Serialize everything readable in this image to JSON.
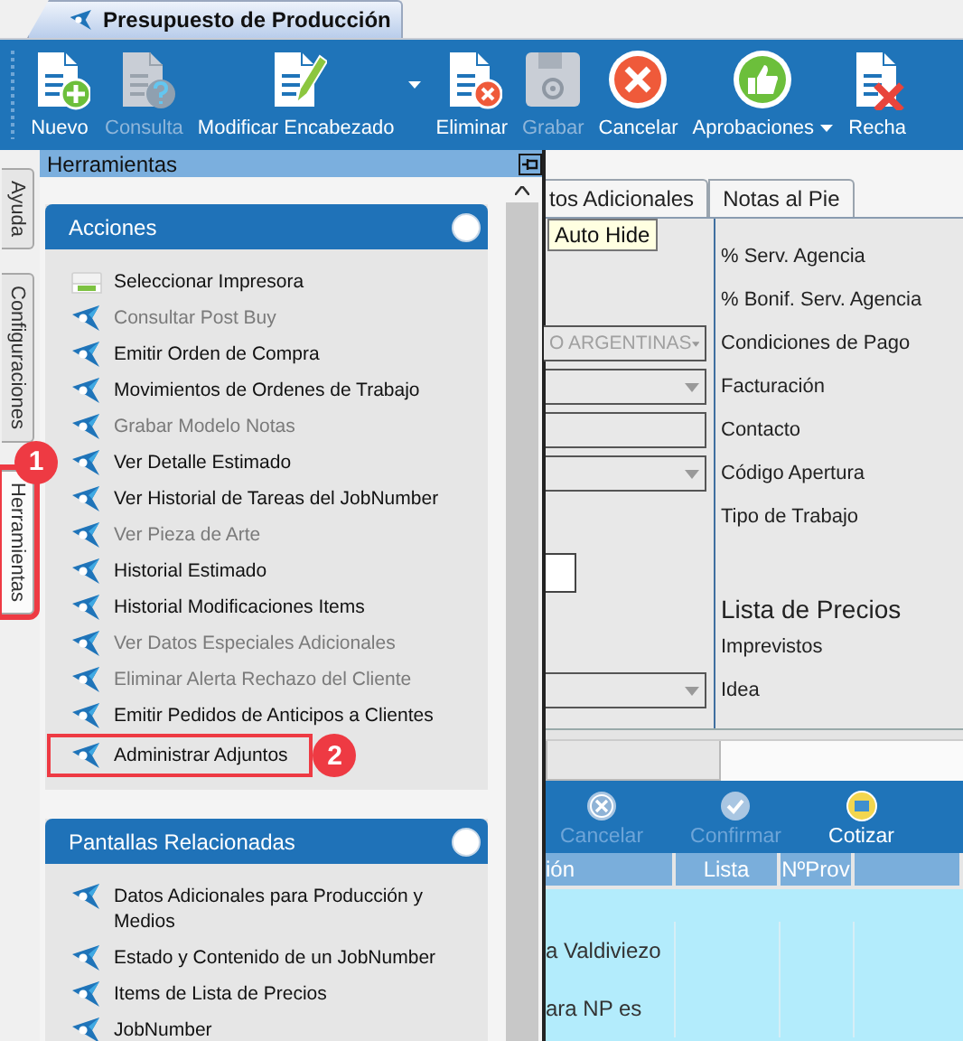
{
  "window_tab": {
    "title": "Presupuesto de Producción"
  },
  "toolbar": [
    {
      "label": "Nuevo",
      "kind": "new",
      "disabled": false,
      "dropdown": false
    },
    {
      "label": "Consulta",
      "kind": "query",
      "disabled": true,
      "dropdown": false
    },
    {
      "label": "Modificar Encabezado",
      "kind": "edit",
      "disabled": false,
      "dropdown": true,
      "split": true
    },
    {
      "label": "Eliminar",
      "kind": "delete",
      "disabled": false,
      "dropdown": false
    },
    {
      "label": "Grabar",
      "kind": "save",
      "disabled": true,
      "dropdown": false
    },
    {
      "label": "Cancelar",
      "kind": "cancel",
      "disabled": false,
      "dropdown": false
    },
    {
      "label": "Aprobaciones",
      "kind": "approve",
      "disabled": false,
      "dropdown": true,
      "split": false
    },
    {
      "label": "Recha",
      "kind": "reject",
      "disabled": false,
      "dropdown": false
    }
  ],
  "side_tabs": [
    {
      "label": "Ayuda",
      "selected": false
    },
    {
      "label": "Configuraciones",
      "selected": false
    },
    {
      "label": "Herramientas",
      "selected": true,
      "callout": "1"
    }
  ],
  "tools_panel": {
    "title": "Herramientas",
    "tooltip": "Auto Hide",
    "groups": [
      {
        "title": "Acciones",
        "items": [
          {
            "label": "Seleccionar Impresora",
            "kind": "printer",
            "disabled": false
          },
          {
            "label": "Consultar Post Buy",
            "kind": "action",
            "disabled": true
          },
          {
            "label": "Emitir Orden de Compra",
            "kind": "action",
            "disabled": false
          },
          {
            "label": "Movimientos de Ordenes de Trabajo",
            "kind": "action",
            "disabled": false
          },
          {
            "label": "Grabar Modelo Notas",
            "kind": "action",
            "disabled": true
          },
          {
            "label": "Ver Detalle Estimado",
            "kind": "action",
            "disabled": false
          },
          {
            "label": "Ver Historial de Tareas del JobNumber",
            "kind": "action",
            "disabled": false
          },
          {
            "label": "Ver Pieza de Arte",
            "kind": "action",
            "disabled": true
          },
          {
            "label": "Historial Estimado",
            "kind": "action",
            "disabled": false
          },
          {
            "label": "Historial Modificaciones Items",
            "kind": "action",
            "disabled": false
          },
          {
            "label": "Ver Datos Especiales Adicionales",
            "kind": "action",
            "disabled": true
          },
          {
            "label": "Eliminar Alerta Rechazo del Cliente",
            "kind": "action",
            "disabled": true
          },
          {
            "label": "Emitir Pedidos de Anticipos a Clientes",
            "kind": "action",
            "disabled": false
          },
          {
            "label": "Administrar Adjuntos",
            "kind": "action",
            "disabled": false,
            "callout": "2"
          }
        ]
      },
      {
        "title": "Pantallas Relacionadas",
        "items": [
          {
            "label": "Datos Adicionales para Producción y Medios",
            "kind": "action",
            "disabled": false
          },
          {
            "label": "Estado y Contenido de un JobNumber",
            "kind": "action",
            "disabled": false
          },
          {
            "label": "Items de Lista de Precios",
            "kind": "action",
            "disabled": false
          },
          {
            "label": "JobNumber",
            "kind": "action",
            "disabled": false
          }
        ]
      }
    ]
  },
  "form": {
    "tabs": [
      {
        "label": "tos Adicionales"
      },
      {
        "label": "Notas al Pie"
      }
    ],
    "rows": [
      {
        "kind": "label",
        "label": "% Serv. Agencia"
      },
      {
        "kind": "label",
        "label": "% Bonif. Serv. Agencia"
      },
      {
        "kind": "label",
        "label": "Condiciones de Pago",
        "field": {
          "kind": "combo",
          "value": "O ARGENTINAS",
          "disabled": true
        }
      },
      {
        "kind": "label",
        "label": "Facturación",
        "field": {
          "kind": "combo"
        }
      },
      {
        "kind": "label",
        "label": "Contacto",
        "field": {
          "kind": "text"
        }
      },
      {
        "kind": "label",
        "label": "Código Apertura",
        "field": {
          "kind": "combo"
        }
      },
      {
        "kind": "label",
        "label": "Tipo de Trabajo"
      },
      {
        "kind": "field",
        "field": {
          "kind": "box"
        }
      },
      {
        "kind": "heading",
        "label": "Lista de Precios"
      },
      {
        "kind": "label",
        "label": "Imprevistos"
      },
      {
        "kind": "label",
        "label": "Idea",
        "field": {
          "kind": "combo"
        }
      }
    ]
  },
  "grid_toolbar": [
    {
      "label": "Cancelar",
      "kind": "cancel",
      "disabled": true
    },
    {
      "label": "Confirmar",
      "kind": "confirm",
      "disabled": true
    },
    {
      "label": "Cotizar",
      "kind": "quote",
      "disabled": false
    }
  ],
  "grid": {
    "columns": [
      "ión",
      "Lista",
      "NºProv"
    ],
    "rows": [
      [
        "a Valdiviezo",
        "",
        ""
      ],
      [
        "ara NP es",
        "",
        ""
      ]
    ]
  }
}
